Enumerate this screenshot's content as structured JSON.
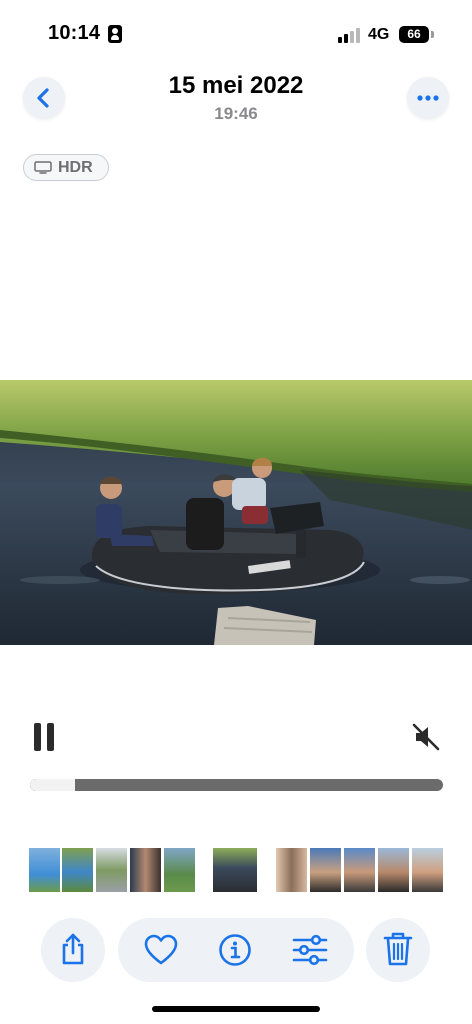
{
  "status_bar": {
    "time": "10:14",
    "network": "4G",
    "battery": "66"
  },
  "header": {
    "date": "15 mei 2022",
    "time": "19:46",
    "back_icon": "chevron-left-icon",
    "more_icon": "ellipsis-icon"
  },
  "badge": {
    "label": "HDR",
    "icon": "monitor-icon"
  },
  "playback": {
    "progress": 0.11,
    "muted": true
  },
  "toolbar": {
    "icons": [
      "share-icon",
      "heart-icon",
      "info-icon",
      "adjust-icon",
      "trash-icon"
    ]
  },
  "colors": {
    "accent": "#1a73e8",
    "button_bg": "#eef1f5",
    "scrubber_track": "#6b6b6b",
    "scrubber_fill": "#f2f2f2"
  }
}
